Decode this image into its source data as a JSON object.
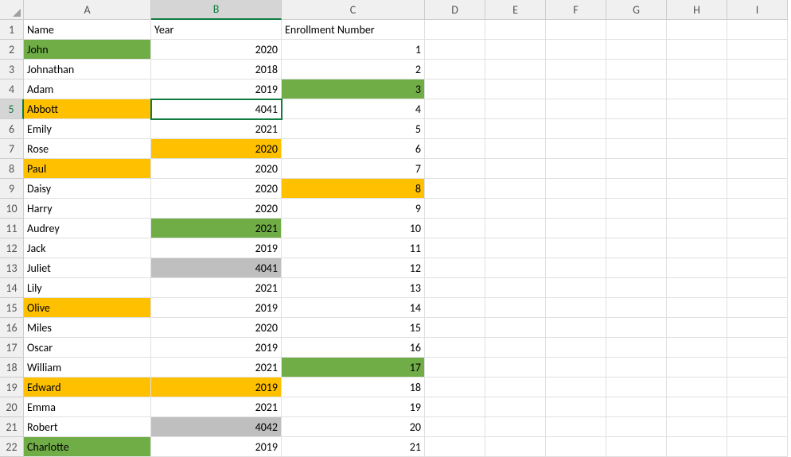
{
  "columns": [
    "A",
    "B",
    "C",
    "D",
    "E",
    "F",
    "G",
    "H",
    "I"
  ],
  "rowNumbers": [
    1,
    2,
    3,
    4,
    5,
    6,
    7,
    8,
    9,
    10,
    11,
    12,
    13,
    14,
    15,
    16,
    17,
    18,
    19,
    20,
    21,
    22
  ],
  "active": {
    "col": "B",
    "row": 5
  },
  "headers": {
    "A": "Name",
    "B": "Year",
    "C": "Enrollment Number"
  },
  "rows": [
    {
      "n": 2,
      "name": "John",
      "year": 2020,
      "enroll": 1,
      "fillA": "green"
    },
    {
      "n": 3,
      "name": "Johnathan",
      "year": 2018,
      "enroll": 2
    },
    {
      "n": 4,
      "name": "Adam",
      "year": 2019,
      "enroll": 3,
      "fillC": "green"
    },
    {
      "n": 5,
      "name": "Abbott",
      "year": 4041,
      "enroll": 4,
      "fillA": "orange"
    },
    {
      "n": 6,
      "name": "Emily",
      "year": 2021,
      "enroll": 5
    },
    {
      "n": 7,
      "name": "Rose",
      "year": 2020,
      "enroll": 6,
      "fillB": "orange"
    },
    {
      "n": 8,
      "name": "Paul",
      "year": 2020,
      "enroll": 7,
      "fillA": "orange"
    },
    {
      "n": 9,
      "name": "Daisy",
      "year": 2020,
      "enroll": 8,
      "fillC": "orange"
    },
    {
      "n": 10,
      "name": "Harry",
      "year": 2020,
      "enroll": 9
    },
    {
      "n": 11,
      "name": "Audrey",
      "year": 2021,
      "enroll": 10,
      "fillB": "green"
    },
    {
      "n": 12,
      "name": "Jack",
      "year": 2019,
      "enroll": 11
    },
    {
      "n": 13,
      "name": "Juliet",
      "year": 4041,
      "enroll": 12,
      "fillB": "gray"
    },
    {
      "n": 14,
      "name": "Lily",
      "year": 2021,
      "enroll": 13
    },
    {
      "n": 15,
      "name": "Olive",
      "year": 2019,
      "enroll": 14,
      "fillA": "orange"
    },
    {
      "n": 16,
      "name": "Miles",
      "year": 2020,
      "enroll": 15
    },
    {
      "n": 17,
      "name": "Oscar",
      "year": 2019,
      "enroll": 16
    },
    {
      "n": 18,
      "name": "William",
      "year": 2021,
      "enroll": 17,
      "fillC": "green"
    },
    {
      "n": 19,
      "name": "Edward",
      "year": 2019,
      "enroll": 18,
      "fillA": "orange",
      "fillB": "orange"
    },
    {
      "n": 20,
      "name": "Emma",
      "year": 2021,
      "enroll": 19
    },
    {
      "n": 21,
      "name": "Robert",
      "year": 4042,
      "enroll": 20,
      "fillB": "gray"
    },
    {
      "n": 22,
      "name": "Charlotte",
      "year": 2019,
      "enroll": 21,
      "fillA": "green"
    }
  ]
}
